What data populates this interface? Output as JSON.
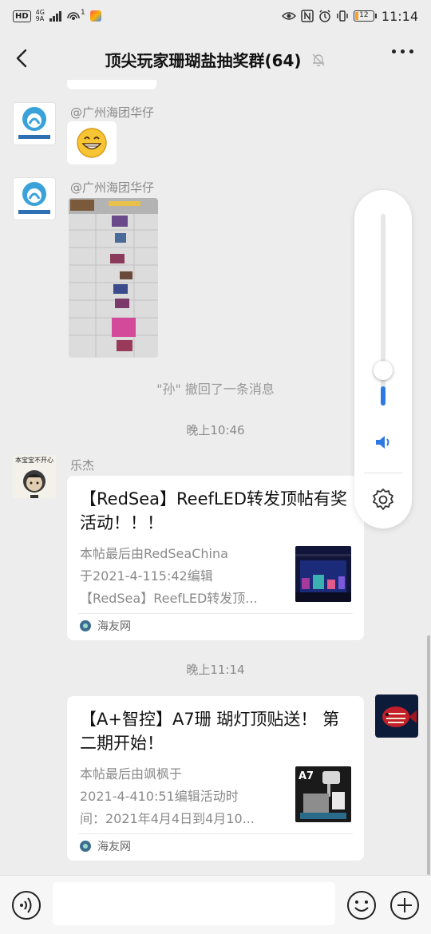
{
  "status_bar": {
    "hd": "HD",
    "net_top": "4G",
    "net_bottom": "9A",
    "hotspot_count": "1",
    "battery": "12",
    "time": "11:14"
  },
  "header": {
    "title": "顶尖玩家珊瑚盐抽奖群(64)"
  },
  "messages": {
    "msg1": {
      "sender": "@广州海团华仔"
    },
    "msg2": {
      "sender": "@广州海团华仔"
    },
    "recall": "\"孙\" 撤回了一条消息",
    "time1": "晚上10:46",
    "msg3": {
      "sender": "乐杰",
      "title": "【RedSea】ReefLED转发顶帖有奖活动！！！",
      "desc": [
        "本帖最后由RedSeaChina",
        "于2021-4-115:42编辑",
        "【RedSea】ReefLED转发顶..."
      ],
      "source": "海友网",
      "thumb_label": ""
    },
    "time2": "晚上11:14",
    "msg4": {
      "title": "【A+智控】A7珊 瑚灯顶贴送！ 第二期开始！",
      "desc": [
        "本帖最后由飒枫于",
        "2021-4-410:51编辑活动时",
        "间：2021年4月4日到4月10..."
      ],
      "source": "海友网",
      "thumb_label": "A7"
    }
  },
  "volume": {
    "level": 0.1,
    "max": 1
  },
  "colors": {
    "accent": "#2e78e4",
    "background": "#ededed"
  }
}
